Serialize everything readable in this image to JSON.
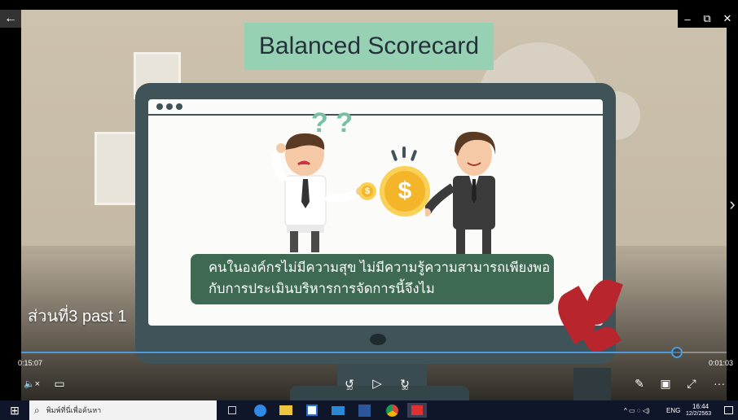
{
  "window": {
    "back_icon": "←",
    "minimize_icon": "–",
    "restore_icon": "⧉",
    "close_icon": "✕",
    "next_icon": "›"
  },
  "video": {
    "title_box": "Balanced Scorecard",
    "question_marks": "? ?",
    "coin_symbol": "$",
    "subtitle_line1": "คนในองค์กรไม่มีความสุข ไม่มีความรู้ความสามารถเพียงพอ",
    "subtitle_line2": "กับการประเมินบริหารการจัดการนี้จึงไม",
    "episode_label": "ส่วนที่3 past 1"
  },
  "player": {
    "current_time": "0:15:07",
    "remaining_time": "0:01:03",
    "progress": 0.93,
    "mute_icon": "🔈×",
    "subtitles_icon": "▭",
    "rewind_label": "10",
    "play_icon": "▷",
    "forward_label": "30",
    "edit_icon": "✎",
    "miniview_icon": "▣",
    "fullscreen_icon": "⤢",
    "more_icon": "···"
  },
  "taskbar": {
    "start_icon": "⊞",
    "search_icon": "⌕",
    "search_placeholder": "พิมพ์ที่นี่เพื่อค้นหา",
    "tray_language": "ENG",
    "clock_time": "16:44",
    "clock_date": "12/2/2563",
    "tray_icons": "^ ▭ ◌ ◁)"
  },
  "colors": {
    "title_bg": "#96d1b3",
    "subtitle_bg": "#3e6a53",
    "monitor": "#3f5359",
    "seek_accent": "#4a9be0",
    "taskbar_bg": "#10162a"
  }
}
